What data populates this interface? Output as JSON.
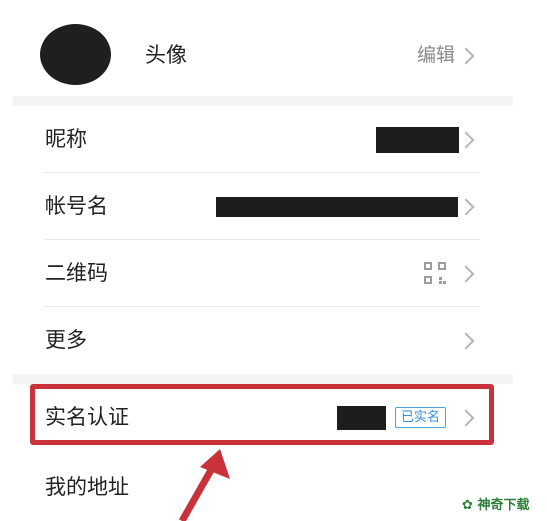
{
  "profile": {
    "avatar_label": "头像",
    "edit_label": "编辑"
  },
  "rows": {
    "nickname": {
      "label": "昵称"
    },
    "account": {
      "label": "帐号名"
    },
    "qrcode": {
      "label": "二维码",
      "icon": "qr-code-icon"
    },
    "more": {
      "label": "更多"
    },
    "realname": {
      "label": "实名认证",
      "badge": "已实名"
    },
    "address": {
      "label": "我的地址"
    }
  },
  "watermark": {
    "text": "神奇下载"
  },
  "colors": {
    "highlight": "#c9323a",
    "badge": "#3b8fd6",
    "watermark": "#2d7f3b"
  }
}
